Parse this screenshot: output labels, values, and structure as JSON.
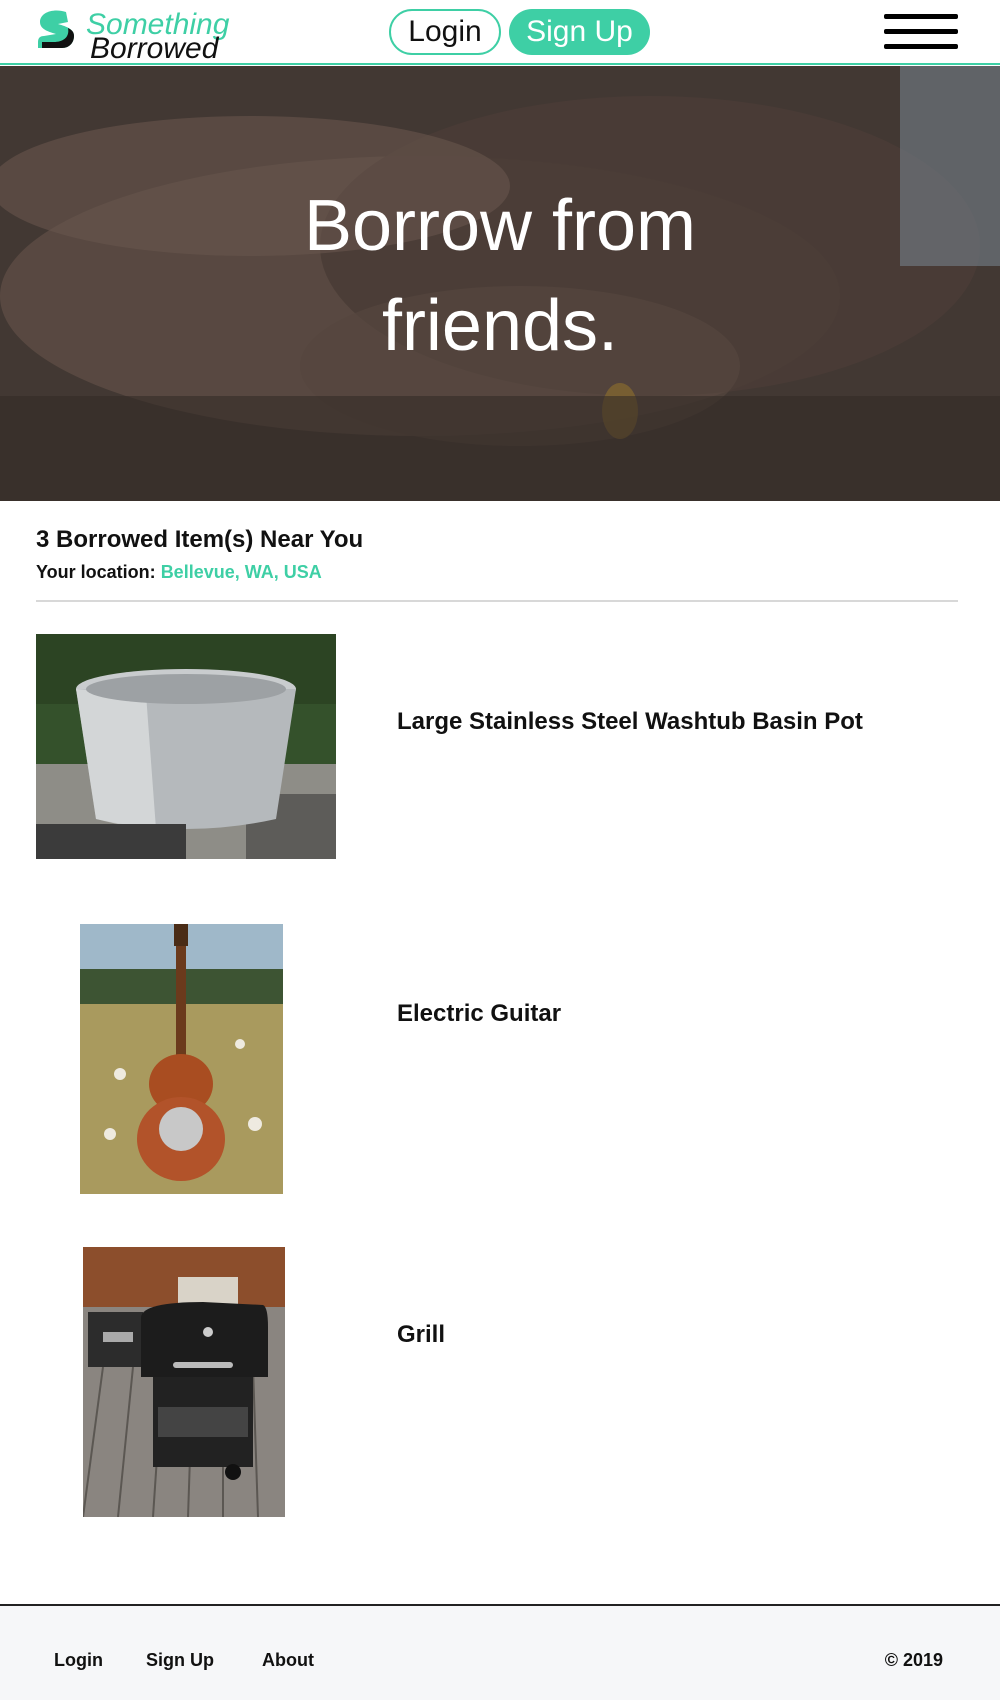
{
  "header": {
    "logo_line1": "Something",
    "logo_line2": "Borrowed",
    "login_label": "Login",
    "signup_label": "Sign Up",
    "menu_icon": "hamburger-menu-icon"
  },
  "hero": {
    "title": "Borrow from friends.",
    "background_image": "handshake-photo"
  },
  "results": {
    "count_text": "3 Borrowed Item(s) Near You",
    "location_label": "Your location:",
    "location_value": "Bellevue, WA, USA",
    "items": [
      {
        "title": "Large Stainless Steel Washtub Basin Pot",
        "image": "washtub-photo"
      },
      {
        "title": "Electric Guitar",
        "image": "guitar-photo"
      },
      {
        "title": "Grill",
        "image": "grill-photo"
      }
    ]
  },
  "footer": {
    "links": [
      "Login",
      "Sign Up",
      "About"
    ],
    "copyright": "© 2019"
  },
  "colors": {
    "accent": "#3ecfa5",
    "text": "#111111",
    "footer_bg": "#f6f7f9"
  }
}
